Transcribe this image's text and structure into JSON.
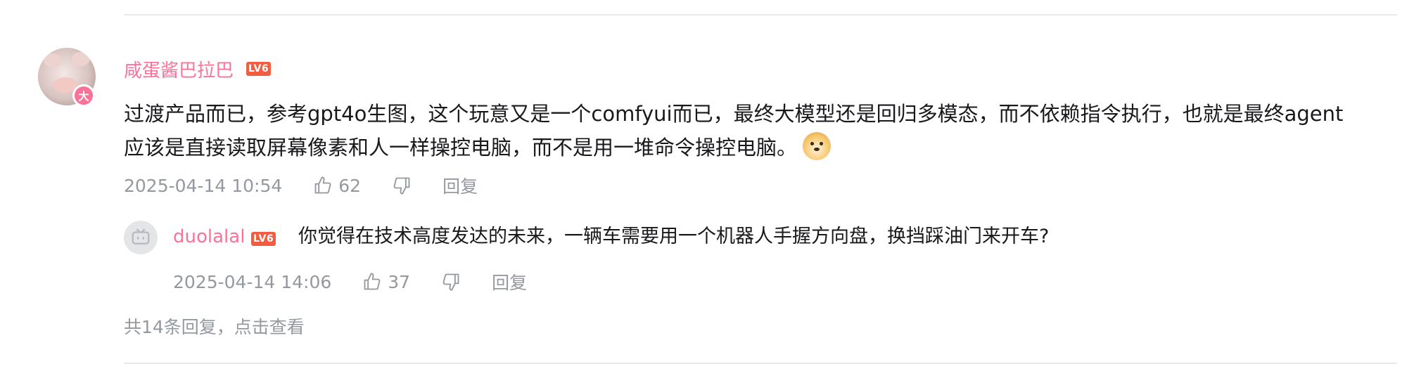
{
  "comment": {
    "username": "咸蛋酱巴拉巴",
    "level": "LV6",
    "vip_badge": "大",
    "text_line1": "过渡产品而已，参考gpt4o生图，这个玩意又是一个comfyui而已，最终大模型还是回归多模态，而不依赖指令执行，也就是最终agent",
    "text_line2": "应该是直接读取屏幕像素和人一样操控电脑，而不是用一堆命令操控电脑。",
    "emoji": "doge-emoji",
    "time": "2025-04-14 10:54",
    "likes": "62",
    "reply_label": "回复"
  },
  "sub_reply": {
    "username": "duolalal",
    "level": "LV6",
    "text": "你觉得在技术高度发达的未来，一辆车需要用一个机器人手握方向盘，换挡踩油门来开车?",
    "time": "2025-04-14 14:06",
    "likes": "37",
    "reply_label": "回复"
  },
  "more_replies": "共14条回复，点击查看",
  "colors": {
    "username": "#fb7299",
    "level_badge": "#f25d42",
    "meta_text": "#9499a0",
    "divider": "#e8e9eb"
  }
}
